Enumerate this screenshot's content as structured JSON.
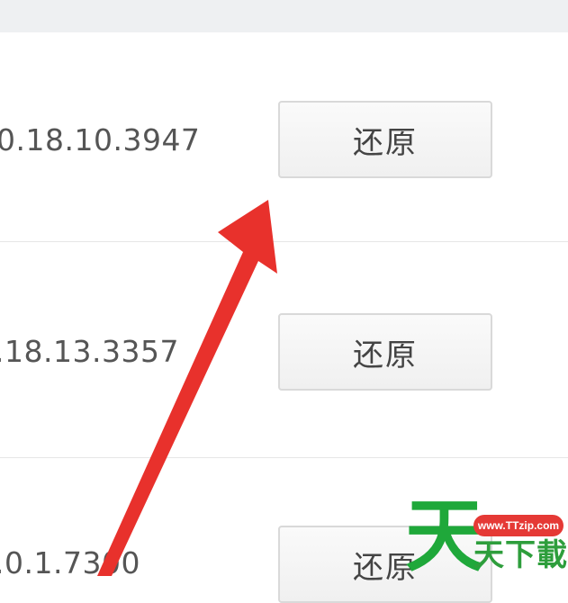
{
  "rows": [
    {
      "version": "0.18.10.3947",
      "button_label": "还原"
    },
    {
      "version": ".18.13.3357",
      "button_label": "还原"
    },
    {
      "version": ".0.1.7300",
      "button_label": "还原"
    }
  ],
  "watermark": {
    "glyph": "天",
    "url": "www.TTzip.com",
    "text": "天下載"
  },
  "colors": {
    "arrow": "#e8312c",
    "watermark_green": "#1fa83a",
    "watermark_badge": "#e53935"
  }
}
